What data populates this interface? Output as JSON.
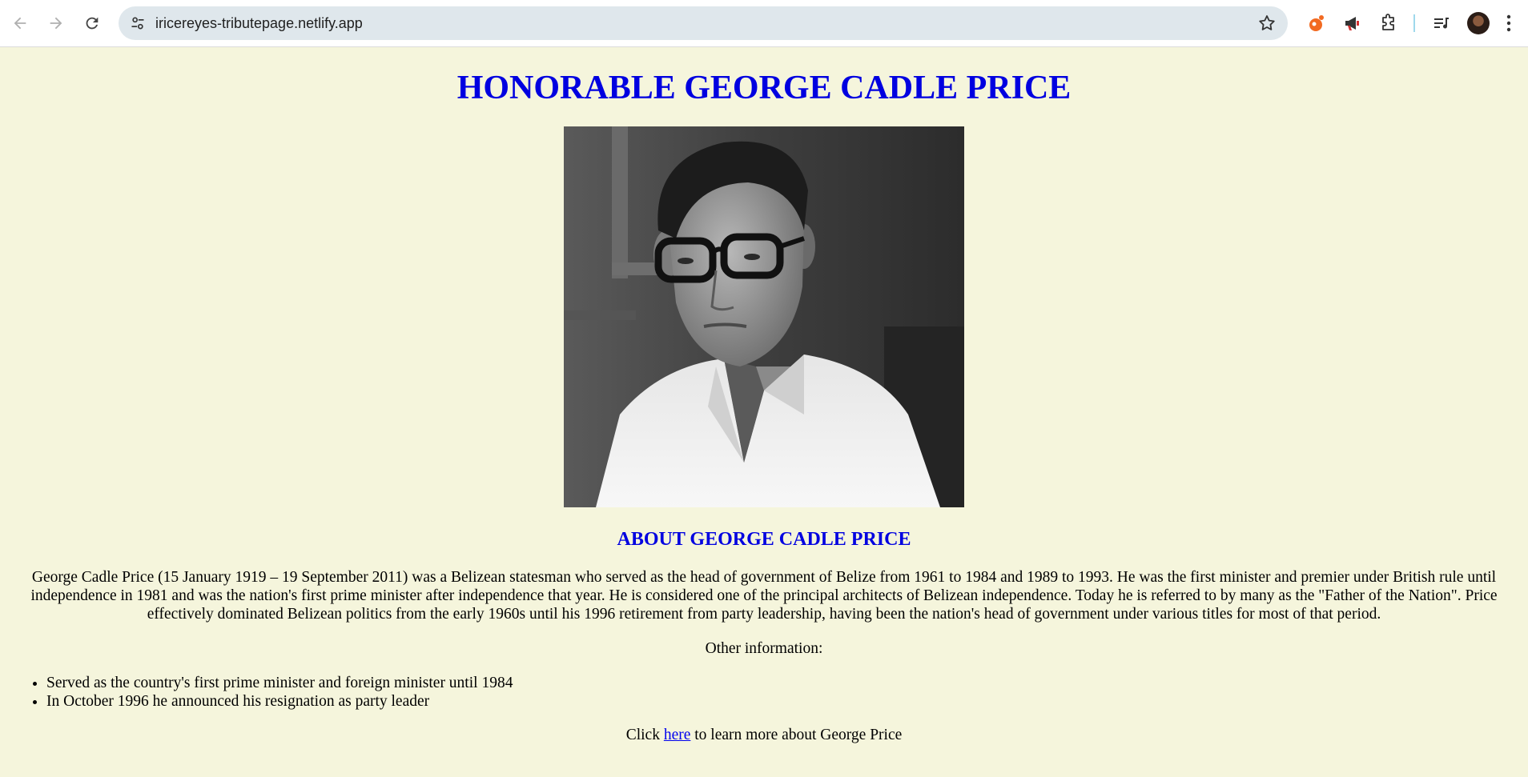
{
  "browser": {
    "url": "iricereyes-tributepage.netlify.app",
    "icons": {
      "back": "arrow-left-icon",
      "forward": "arrow-right-icon",
      "reload": "reload-icon",
      "site_info": "tune-icon",
      "bookmark": "star-icon",
      "extensions": [
        "orange-extension-icon",
        "megaphone-icon",
        "puzzle-icon"
      ],
      "media": "media-queue-icon",
      "profile": "avatar",
      "menu": "kebab-menu-icon"
    }
  },
  "page": {
    "title": "HONORABLE GEORGE CADLE PRICE",
    "image_alt": "Portrait of George Cadle Price",
    "about_heading": "ABOUT GEORGE CADLE PRICE",
    "bio": "George Cadle Price (15 January 1919 – 19 September 2011) was a Belizean statesman who served as the head of government of Belize from 1961 to 1984 and 1989 to 1993. He was the first minister and premier under British rule until independence in 1981 and was the nation's first prime minister after independence that year. He is considered one of the principal architects of Belizean independence. Today he is referred to by many as the \"Father of the Nation\". Price effectively dominated Belizean politics from the early 1960s until his 1996 retirement from party leadership, having been the nation's head of government under various titles for most of that period.",
    "other_heading": "Other information:",
    "facts": [
      "Served as the country's first prime minister and foreign minister until 1984",
      "In October 1996 he announced his resignation as party leader"
    ],
    "cta": {
      "prefix": "Click ",
      "link_text": "here",
      "suffix": " to learn more about George Price"
    }
  },
  "colors": {
    "background": "#f5f5dc",
    "heading": "#0000e0",
    "link": "#0000ee"
  }
}
